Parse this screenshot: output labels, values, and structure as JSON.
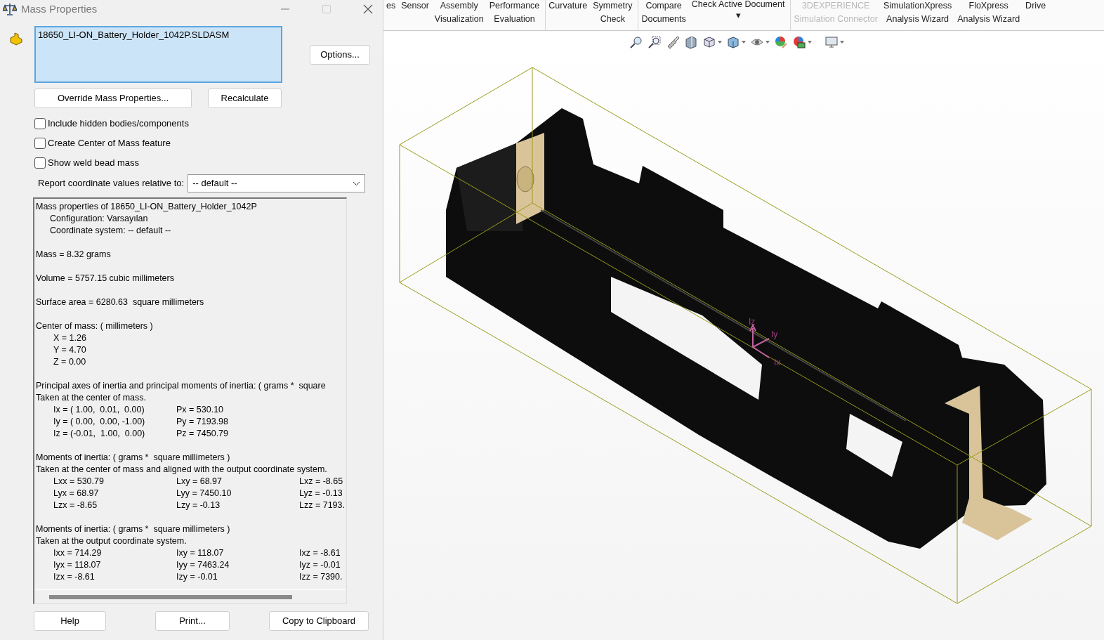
{
  "window": {
    "title": "Mass Properties"
  },
  "selection_list": {
    "items": [
      "18650_LI-ON_Battery_Holder_1042P.SLDASM"
    ]
  },
  "buttons_top": {
    "options": "Options...",
    "override": "Override Mass Properties...",
    "recalculate": "Recalculate"
  },
  "checkboxes": [
    {
      "label": "Include hidden bodies/components",
      "checked": false
    },
    {
      "label": "Create Center of Mass feature",
      "checked": false
    },
    {
      "label": "Show weld bead mass",
      "checked": false
    }
  ],
  "coordinate_select": {
    "label": "Report coordinate values relative to:",
    "value": "-- default --"
  },
  "report": [
    {
      "kind": "heading",
      "text": "Mass properties of 18650_LI-ON_Battery_Holder_1042P"
    },
    {
      "kind": "sub",
      "text": "Configuration: Varsayılan"
    },
    {
      "kind": "sub",
      "text": "Coordinate system: -- default --"
    },
    {
      "kind": "gap"
    },
    {
      "kind": "heading",
      "text": "Mass = 8.32 grams"
    },
    {
      "kind": "gap"
    },
    {
      "kind": "heading",
      "text": "Volume = 5757.15 cubic millimeters"
    },
    {
      "kind": "gap"
    },
    {
      "kind": "heading",
      "text": "Surface area = 6280.63  square millimeters"
    },
    {
      "kind": "gap"
    },
    {
      "kind": "heading",
      "text": "Center of mass: ( millimeters )"
    },
    {
      "kind": "row",
      "cells": [
        "X = 1.26"
      ]
    },
    {
      "kind": "row",
      "cells": [
        "Y = 4.70"
      ]
    },
    {
      "kind": "row",
      "cells": [
        "Z = 0.00"
      ]
    },
    {
      "kind": "gap"
    },
    {
      "kind": "heading",
      "text": "Principal axes of inertia and principal moments of inertia: ( grams *  square"
    },
    {
      "kind": "heading",
      "text": "Taken at the center of mass."
    },
    {
      "kind": "row",
      "cells": [
        "Ix = ( 1.00,  0.01,  0.00)",
        "Px = 530.10"
      ]
    },
    {
      "kind": "row",
      "cells": [
        "Iy = ( 0.00,  0.00, -1.00)",
        "Py = 7193.98"
      ]
    },
    {
      "kind": "row",
      "cells": [
        "Iz = (-0.01,  1.00,  0.00)",
        "Pz = 7450.79"
      ]
    },
    {
      "kind": "gap"
    },
    {
      "kind": "heading",
      "text": "Moments of inertia: ( grams *  square millimeters )"
    },
    {
      "kind": "heading",
      "text": "Taken at the center of mass and aligned with the output coordinate system."
    },
    {
      "kind": "row",
      "cells": [
        "Lxx = 530.79",
        "Lxy = 68.97",
        "Lxz = -8.65"
      ]
    },
    {
      "kind": "row",
      "cells": [
        "Lyx = 68.97",
        "Lyy = 7450.10",
        "Lyz = -0.13"
      ]
    },
    {
      "kind": "row",
      "cells": [
        "Lzx = -8.65",
        "Lzy = -0.13",
        "Lzz = 7193."
      ]
    },
    {
      "kind": "gap"
    },
    {
      "kind": "heading",
      "text": "Moments of inertia: ( grams *  square millimeters )"
    },
    {
      "kind": "heading",
      "text": "Taken at the output coordinate system."
    },
    {
      "kind": "row",
      "cells": [
        "Ixx = 714.29",
        "Ixy = 118.07",
        "Ixz = -8.61"
      ]
    },
    {
      "kind": "row",
      "cells": [
        "Iyx = 118.07",
        "Iyy = 7463.24",
        "Iyz = -0.01"
      ]
    },
    {
      "kind": "row",
      "cells": [
        "Izx = -8.61",
        "Izy = -0.01",
        "Izz = 7390."
      ]
    }
  ],
  "buttons_bottom": [
    "Help",
    "Print...",
    "Copy to Clipboard"
  ],
  "ribbon": [
    {
      "lines": [
        "es"
      ],
      "disabled": false
    },
    {
      "lines": [
        "Sensor"
      ],
      "disabled": false
    },
    {
      "lines": [
        "Assembly",
        "Visualization"
      ],
      "disabled": false
    },
    {
      "lines": [
        "Performance",
        "Evaluation"
      ],
      "disabled": false
    },
    {
      "lines": [
        "Curvature"
      ],
      "disabled": false
    },
    {
      "lines": [
        "Symmetry",
        "Check"
      ],
      "disabled": false
    },
    {
      "lines": [
        "Compare",
        "Documents"
      ],
      "disabled": false
    },
    {
      "lines": [
        "Check Active Document",
        "▾"
      ],
      "disabled": false
    },
    {
      "lines": [
        "3DEXPERIENCE",
        "Simulation Connector"
      ],
      "disabled": true
    },
    {
      "lines": [
        "SimulationXpress",
        "Analysis Wizard"
      ],
      "disabled": false
    },
    {
      "lines": [
        "FloXpress",
        "Analysis Wizard"
      ],
      "disabled": false
    },
    {
      "lines": [
        "Drive"
      ],
      "disabled": false
    }
  ],
  "triad": {
    "z": "Iz",
    "y": "Iy",
    "x": "Ix"
  }
}
